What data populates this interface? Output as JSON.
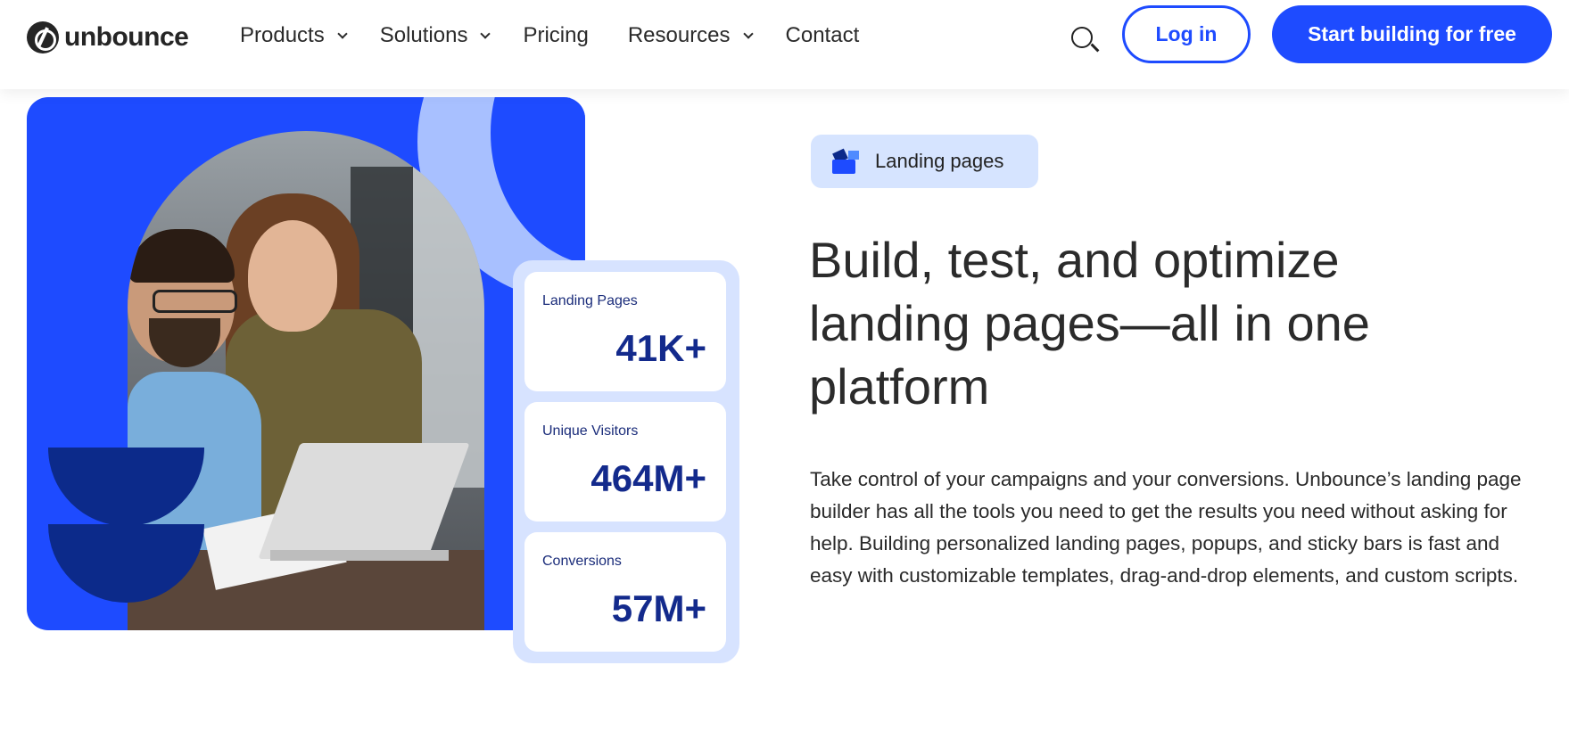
{
  "brand": {
    "name": "unbounce"
  },
  "nav": {
    "items": [
      {
        "label": "Products",
        "has_dropdown": true
      },
      {
        "label": "Solutions",
        "has_dropdown": true
      },
      {
        "label": "Pricing",
        "has_dropdown": false
      },
      {
        "label": "Resources",
        "has_dropdown": true
      },
      {
        "label": "Contact",
        "has_dropdown": false
      }
    ]
  },
  "header": {
    "search_icon": "search-icon",
    "login_label": "Log in",
    "cta_label": "Start building for free"
  },
  "hero": {
    "badge_label": "Landing pages",
    "headline": "Build, test, and optimize landing pages—all in one platform",
    "paragraph": "Take control of your campaigns and your conversions. Unbounce’s landing page builder has all the tools you need to get the results you need without asking for help. Building personalized landing pages, popups, and sticky bars is fast and easy with customizable templates, drag-and-drop elements, and custom scripts."
  },
  "stats": [
    {
      "label": "Landing Pages",
      "value": "41K+"
    },
    {
      "label": "Unique Visitors",
      "value": "464M+"
    },
    {
      "label": "Conversions",
      "value": "57M+"
    }
  ],
  "colors": {
    "accent": "#1e4bff",
    "dark_blue": "#0c2a8a",
    "light_blue": "#d7e3ff",
    "text": "#2a2a2a"
  }
}
